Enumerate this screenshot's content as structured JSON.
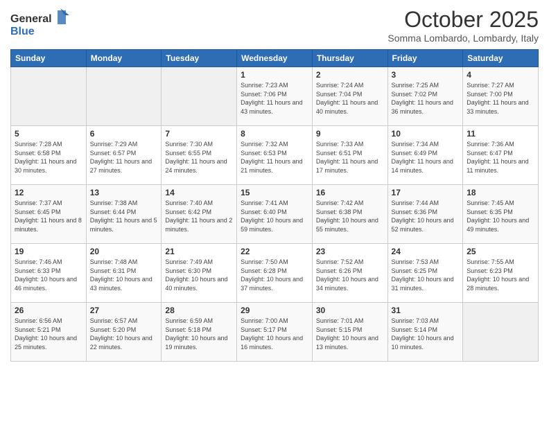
{
  "header": {
    "logo_general": "General",
    "logo_blue": "Blue",
    "month_title": "October 2025",
    "location": "Somma Lombardo, Lombardy, Italy"
  },
  "days_of_week": [
    "Sunday",
    "Monday",
    "Tuesday",
    "Wednesday",
    "Thursday",
    "Friday",
    "Saturday"
  ],
  "weeks": [
    [
      {
        "day": "",
        "empty": true
      },
      {
        "day": "",
        "empty": true
      },
      {
        "day": "",
        "empty": true
      },
      {
        "day": "1",
        "sunrise": "7:23 AM",
        "sunset": "7:06 PM",
        "daylight": "11 hours and 43 minutes."
      },
      {
        "day": "2",
        "sunrise": "7:24 AM",
        "sunset": "7:04 PM",
        "daylight": "11 hours and 40 minutes."
      },
      {
        "day": "3",
        "sunrise": "7:25 AM",
        "sunset": "7:02 PM",
        "daylight": "11 hours and 36 minutes."
      },
      {
        "day": "4",
        "sunrise": "7:27 AM",
        "sunset": "7:00 PM",
        "daylight": "11 hours and 33 minutes."
      }
    ],
    [
      {
        "day": "5",
        "sunrise": "7:28 AM",
        "sunset": "6:58 PM",
        "daylight": "11 hours and 30 minutes."
      },
      {
        "day": "6",
        "sunrise": "7:29 AM",
        "sunset": "6:57 PM",
        "daylight": "11 hours and 27 minutes."
      },
      {
        "day": "7",
        "sunrise": "7:30 AM",
        "sunset": "6:55 PM",
        "daylight": "11 hours and 24 minutes."
      },
      {
        "day": "8",
        "sunrise": "7:32 AM",
        "sunset": "6:53 PM",
        "daylight": "11 hours and 21 minutes."
      },
      {
        "day": "9",
        "sunrise": "7:33 AM",
        "sunset": "6:51 PM",
        "daylight": "11 hours and 17 minutes."
      },
      {
        "day": "10",
        "sunrise": "7:34 AM",
        "sunset": "6:49 PM",
        "daylight": "11 hours and 14 minutes."
      },
      {
        "day": "11",
        "sunrise": "7:36 AM",
        "sunset": "6:47 PM",
        "daylight": "11 hours and 11 minutes."
      }
    ],
    [
      {
        "day": "12",
        "sunrise": "7:37 AM",
        "sunset": "6:45 PM",
        "daylight": "11 hours and 8 minutes."
      },
      {
        "day": "13",
        "sunrise": "7:38 AM",
        "sunset": "6:44 PM",
        "daylight": "11 hours and 5 minutes."
      },
      {
        "day": "14",
        "sunrise": "7:40 AM",
        "sunset": "6:42 PM",
        "daylight": "11 hours and 2 minutes."
      },
      {
        "day": "15",
        "sunrise": "7:41 AM",
        "sunset": "6:40 PM",
        "daylight": "10 hours and 59 minutes."
      },
      {
        "day": "16",
        "sunrise": "7:42 AM",
        "sunset": "6:38 PM",
        "daylight": "10 hours and 55 minutes."
      },
      {
        "day": "17",
        "sunrise": "7:44 AM",
        "sunset": "6:36 PM",
        "daylight": "10 hours and 52 minutes."
      },
      {
        "day": "18",
        "sunrise": "7:45 AM",
        "sunset": "6:35 PM",
        "daylight": "10 hours and 49 minutes."
      }
    ],
    [
      {
        "day": "19",
        "sunrise": "7:46 AM",
        "sunset": "6:33 PM",
        "daylight": "10 hours and 46 minutes."
      },
      {
        "day": "20",
        "sunrise": "7:48 AM",
        "sunset": "6:31 PM",
        "daylight": "10 hours and 43 minutes."
      },
      {
        "day": "21",
        "sunrise": "7:49 AM",
        "sunset": "6:30 PM",
        "daylight": "10 hours and 40 minutes."
      },
      {
        "day": "22",
        "sunrise": "7:50 AM",
        "sunset": "6:28 PM",
        "daylight": "10 hours and 37 minutes."
      },
      {
        "day": "23",
        "sunrise": "7:52 AM",
        "sunset": "6:26 PM",
        "daylight": "10 hours and 34 minutes."
      },
      {
        "day": "24",
        "sunrise": "7:53 AM",
        "sunset": "6:25 PM",
        "daylight": "10 hours and 31 minutes."
      },
      {
        "day": "25",
        "sunrise": "7:55 AM",
        "sunset": "6:23 PM",
        "daylight": "10 hours and 28 minutes."
      }
    ],
    [
      {
        "day": "26",
        "sunrise": "6:56 AM",
        "sunset": "5:21 PM",
        "daylight": "10 hours and 25 minutes."
      },
      {
        "day": "27",
        "sunrise": "6:57 AM",
        "sunset": "5:20 PM",
        "daylight": "10 hours and 22 minutes."
      },
      {
        "day": "28",
        "sunrise": "6:59 AM",
        "sunset": "5:18 PM",
        "daylight": "10 hours and 19 minutes."
      },
      {
        "day": "29",
        "sunrise": "7:00 AM",
        "sunset": "5:17 PM",
        "daylight": "10 hours and 16 minutes."
      },
      {
        "day": "30",
        "sunrise": "7:01 AM",
        "sunset": "5:15 PM",
        "daylight": "10 hours and 13 minutes."
      },
      {
        "day": "31",
        "sunrise": "7:03 AM",
        "sunset": "5:14 PM",
        "daylight": "10 hours and 10 minutes."
      },
      {
        "day": "",
        "empty": true
      }
    ]
  ],
  "labels": {
    "sunrise": "Sunrise:",
    "sunset": "Sunset:",
    "daylight": "Daylight:"
  }
}
